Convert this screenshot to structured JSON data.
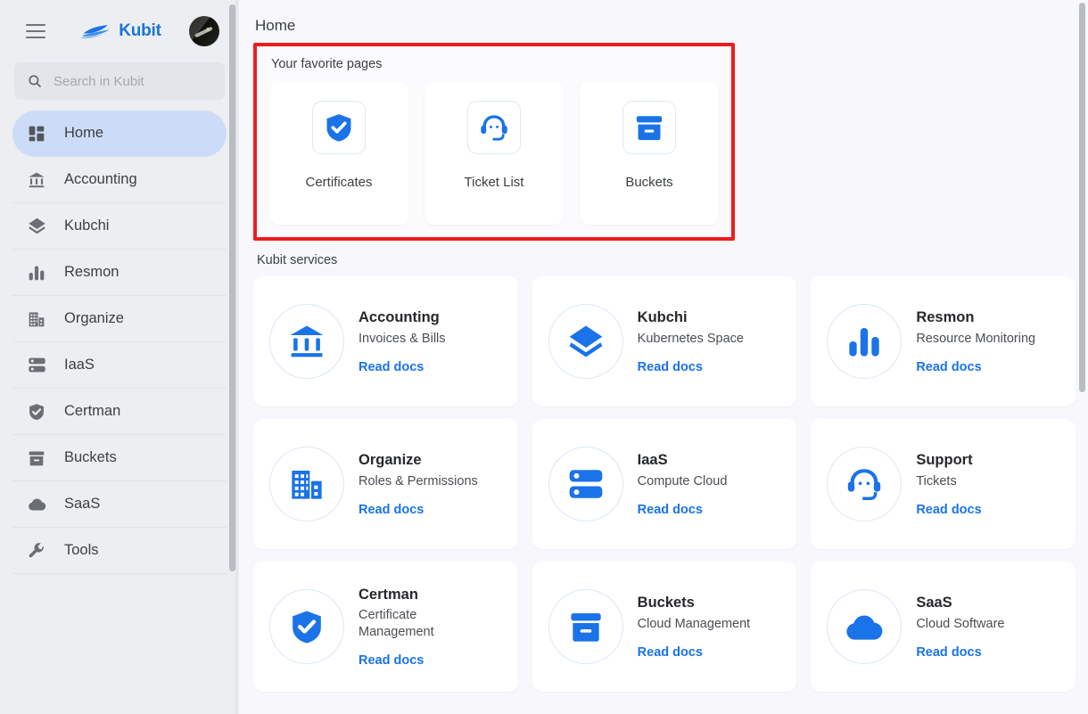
{
  "sidebar": {
    "menu_icon": "hamburger-icon",
    "brand": {
      "name": "Kubit",
      "logo": "kubit-boat-logo"
    },
    "avatar": "user-avatar",
    "search": {
      "placeholder": "Search in Kubit",
      "value": "",
      "icon": "search-icon"
    },
    "items": [
      {
        "label": "Home",
        "icon": "dashboard-icon",
        "active": true
      },
      {
        "label": "Accounting",
        "icon": "bank-icon",
        "active": false
      },
      {
        "label": "Kubchi",
        "icon": "layers-icon",
        "active": false
      },
      {
        "label": "Resmon",
        "icon": "bar-chart-icon",
        "active": false
      },
      {
        "label": "Organize",
        "icon": "building-icon",
        "active": false
      },
      {
        "label": "IaaS",
        "icon": "server-icon",
        "active": false
      },
      {
        "label": "Certman",
        "icon": "shield-check-icon",
        "active": false
      },
      {
        "label": "Buckets",
        "icon": "bucket-icon",
        "active": false
      },
      {
        "label": "SaaS",
        "icon": "cloud-icon",
        "active": false
      },
      {
        "label": "Tools",
        "icon": "wrench-icon",
        "active": false
      }
    ]
  },
  "main": {
    "page_title": "Home",
    "favorites": {
      "label": "Your favorite pages",
      "highlight_color": "#ee1c1c",
      "cards": [
        {
          "label": "Certificates",
          "icon": "shield-check-icon"
        },
        {
          "label": "Ticket List",
          "icon": "headset-icon"
        },
        {
          "label": "Buckets",
          "icon": "bucket-icon"
        }
      ]
    },
    "services": {
      "label": "Kubit services",
      "link_label": "Read docs",
      "link_color": "#1a73e8",
      "cards": [
        {
          "title": "Accounting",
          "subtitle": "Invoices & Bills",
          "icon": "bank-icon",
          "link": "Read docs"
        },
        {
          "title": "Kubchi",
          "subtitle": "Kubernetes Space",
          "icon": "layers-icon",
          "link": "Read docs"
        },
        {
          "title": "Resmon",
          "subtitle": "Resource Monitoring",
          "icon": "bar-chart-icon",
          "link": "Read docs"
        },
        {
          "title": "Organize",
          "subtitle": "Roles & Permissions",
          "icon": "building-icon",
          "link": "Read docs"
        },
        {
          "title": "IaaS",
          "subtitle": "Compute Cloud",
          "icon": "server-icon",
          "link": "Read docs"
        },
        {
          "title": "Support",
          "subtitle": "Tickets",
          "icon": "headset-icon",
          "link": "Read docs"
        },
        {
          "title": "Certman",
          "subtitle": "Certificate Management",
          "icon": "shield-check-icon",
          "link": "Read docs"
        },
        {
          "title": "Buckets",
          "subtitle": "Cloud Management",
          "icon": "bucket-icon",
          "link": "Read docs"
        },
        {
          "title": "SaaS",
          "subtitle": "Cloud Software",
          "icon": "cloud-icon",
          "link": "Read docs"
        }
      ]
    }
  }
}
